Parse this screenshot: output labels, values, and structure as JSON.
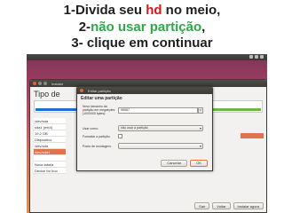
{
  "caption": {
    "line1": {
      "pre": "1-Divida seu ",
      "highlight": "hd",
      "post": " no meio,"
    },
    "line2": {
      "pre": "2-",
      "highlight": "não usar partição",
      "post": ","
    },
    "line3": "3- clique em continuar",
    "colors": {
      "text": "#1f1f1f",
      "red": "#d8141c",
      "green": "#2ea84a"
    }
  },
  "installer": {
    "window_title": "Instalar",
    "heading": "Tipo de",
    "partitions": [
      "/dev/sda",
      "sda1 (ext4)",
      "19.2 GB",
      "Dispositivo",
      "/dev/sda",
      "/dev/sda1",
      "",
      "Nova tabela",
      "Device for boo"
    ],
    "selected_index": 5,
    "buttons": {
      "quit": "Sair",
      "back": "Voltar",
      "install": "Instalar agora"
    }
  },
  "dialog": {
    "window_title": "Editar partição",
    "heading": "Editar uma partição",
    "size_label": "Novo tamanho da partição em megabytes (1000000 bytes):",
    "size_value": "98587",
    "use_as_label": "Usar como:",
    "use_as_value": "não usar a partição",
    "format_label": "Formatar a partição:",
    "format_checked": false,
    "mount_label": "Ponto de montagem:",
    "mount_value": "",
    "cancel_label": "Cancelar",
    "ok_label": "OK"
  },
  "theme": {
    "accent": "#e0734b",
    "titlebar": "#3c3b37",
    "window_bg": "#f2f1f0"
  }
}
